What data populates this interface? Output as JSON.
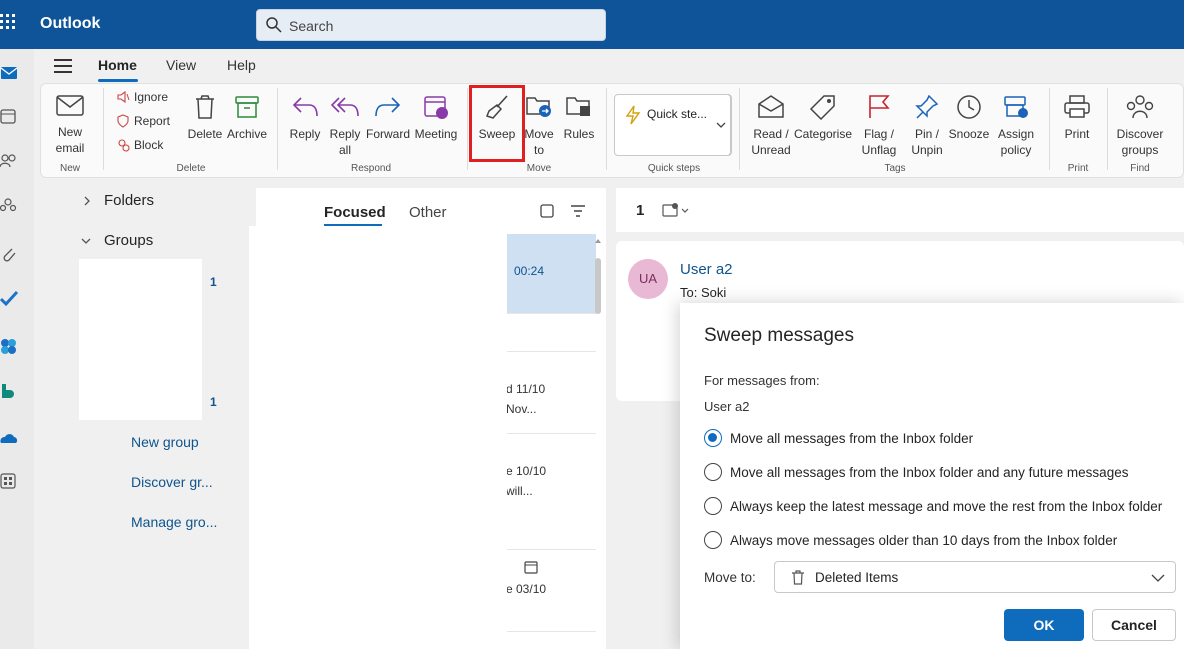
{
  "app": {
    "title": "Outlook"
  },
  "search": {
    "placeholder": "Search"
  },
  "tabs": [
    {
      "label": "Home"
    },
    {
      "label": "View"
    },
    {
      "label": "Help"
    }
  ],
  "ribbon": {
    "new_email": "New email",
    "ignore": "Ignore",
    "report": "Report",
    "block": "Block",
    "delete": "Delete",
    "archive": "Archive",
    "reply": "Reply",
    "reply_all": "Reply all",
    "forward": "Forward",
    "meeting": "Meeting",
    "sweep": "Sweep",
    "move_to": "Move to",
    "rules": "Rules",
    "quick_steps": "Quick ste...",
    "read_unread": "Read / Unread",
    "categorise": "Categorise",
    "flag_unflag": "Flag / Unflag",
    "pin_unpin": "Pin / Unpin",
    "snooze": "Snooze",
    "assign_policy": "Assign policy",
    "print": "Print",
    "discover_groups": "Discover groups",
    "groups": [
      "New",
      "Delete",
      "Respond",
      "Move",
      "Quick steps",
      "Tags",
      "Print",
      "Find"
    ]
  },
  "folders": {
    "folders_label": "Folders",
    "groups_label": "Groups",
    "counts": [
      "1",
      "1"
    ],
    "links": [
      "New group",
      "Discover gr...",
      "Manage gro..."
    ]
  },
  "list": {
    "focused": "Focused",
    "other": "Other",
    "items": [
      {
        "time": "00:24"
      },
      {
        "time": "d 11/10",
        "snippet": "Nov..."
      },
      {
        "time": "e 10/10",
        "snippet": "will..."
      },
      {
        "time": "e 03/10"
      }
    ]
  },
  "reading": {
    "count": "1",
    "sender": "User a2",
    "avatar": "UA",
    "to": "To:  Soki"
  },
  "dialog": {
    "title": "Sweep messages",
    "for_label": "For messages from:",
    "from": "User a2",
    "options": [
      "Move all messages from the Inbox folder",
      "Move all messages from the Inbox folder and any future messages",
      "Always keep the latest message and move the rest from the Inbox folder",
      "Always move messages older than 10 days from the Inbox folder"
    ],
    "selected_option": 0,
    "move_to_label": "Move to:",
    "move_to_value": "Deleted Items",
    "ok": "OK",
    "cancel": "Cancel"
  },
  "colors": {
    "brand": "#0f5499",
    "accent": "#0f6cbd",
    "highlight": "#e02020"
  }
}
